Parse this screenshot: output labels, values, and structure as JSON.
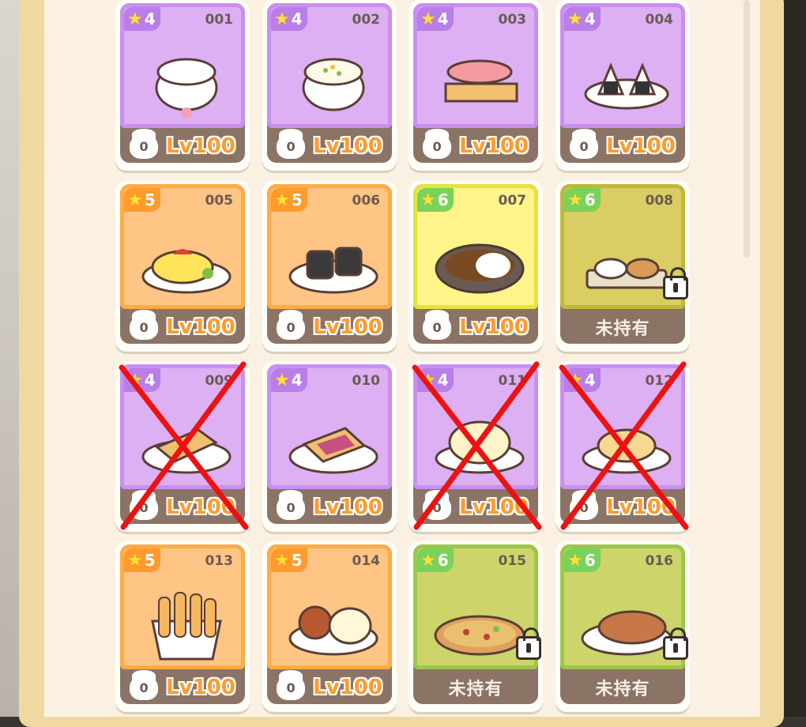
{
  "dishes": [
    {
      "num": "001",
      "stars": "4",
      "rarity": "purple",
      "level": "Lv100",
      "chef_count": "0",
      "owned": true,
      "crossed": false,
      "icon": "rice-bowl-icon"
    },
    {
      "num": "002",
      "stars": "4",
      "rarity": "purple",
      "level": "Lv100",
      "chef_count": "0",
      "owned": true,
      "crossed": false,
      "icon": "fried-rice-icon"
    },
    {
      "num": "003",
      "stars": "4",
      "rarity": "purple",
      "level": "Lv100",
      "chef_count": "0",
      "owned": true,
      "crossed": false,
      "icon": "sushi-icon"
    },
    {
      "num": "004",
      "stars": "4",
      "rarity": "purple",
      "level": "Lv100",
      "chef_count": "0",
      "owned": true,
      "crossed": false,
      "icon": "onigiri-icon"
    },
    {
      "num": "005",
      "stars": "5",
      "rarity": "orange",
      "level": "Lv100",
      "chef_count": "0",
      "owned": true,
      "crossed": false,
      "icon": "omurice-icon"
    },
    {
      "num": "006",
      "stars": "5",
      "rarity": "orange",
      "level": "Lv100",
      "chef_count": "0",
      "owned": true,
      "crossed": false,
      "icon": "seaweed-roll-icon"
    },
    {
      "num": "007",
      "stars": "6",
      "rarity": "yellow",
      "level": "Lv100",
      "chef_count": "0",
      "owned": true,
      "crossed": false,
      "icon": "curry-rice-icon"
    },
    {
      "num": "008",
      "stars": "6",
      "rarity": "locked-yellow",
      "level": "未持有",
      "chef_count": "",
      "owned": false,
      "crossed": false,
      "icon": "set-meal-icon"
    },
    {
      "num": "009",
      "stars": "4",
      "rarity": "purple",
      "level": "Lv100",
      "chef_count": "0",
      "owned": true,
      "crossed": true,
      "icon": "toast-icon"
    },
    {
      "num": "010",
      "stars": "4",
      "rarity": "purple",
      "level": "Lv100",
      "chef_count": "0",
      "owned": true,
      "crossed": false,
      "icon": "jam-toast-icon"
    },
    {
      "num": "011",
      "stars": "4",
      "rarity": "purple",
      "level": "Lv100",
      "chef_count": "0",
      "owned": true,
      "crossed": true,
      "icon": "bun-icon"
    },
    {
      "num": "012",
      "stars": "4",
      "rarity": "purple",
      "level": "Lv100",
      "chef_count": "0",
      "owned": true,
      "crossed": true,
      "icon": "pancake-icon"
    },
    {
      "num": "013",
      "stars": "5",
      "rarity": "orange",
      "level": "Lv100",
      "chef_count": "0",
      "owned": true,
      "crossed": false,
      "icon": "fries-icon"
    },
    {
      "num": "014",
      "stars": "5",
      "rarity": "orange",
      "level": "Lv100",
      "chef_count": "0",
      "owned": true,
      "crossed": false,
      "icon": "bun-plate-icon"
    },
    {
      "num": "015",
      "stars": "6",
      "rarity": "locked-green",
      "level": "未持有",
      "chef_count": "",
      "owned": false,
      "crossed": false,
      "icon": "pizza-icon"
    },
    {
      "num": "016",
      "stars": "6",
      "rarity": "locked-green",
      "level": "未持有",
      "chef_count": "",
      "owned": false,
      "crossed": false,
      "icon": "steak-icon"
    }
  ],
  "colors": {
    "purple": "#dcb0f2",
    "orange": "#ffc585",
    "yellow": "#fff58a",
    "locked": "#e4d76a",
    "level_text": "#ff9b2b",
    "cross": "#ee1111"
  }
}
